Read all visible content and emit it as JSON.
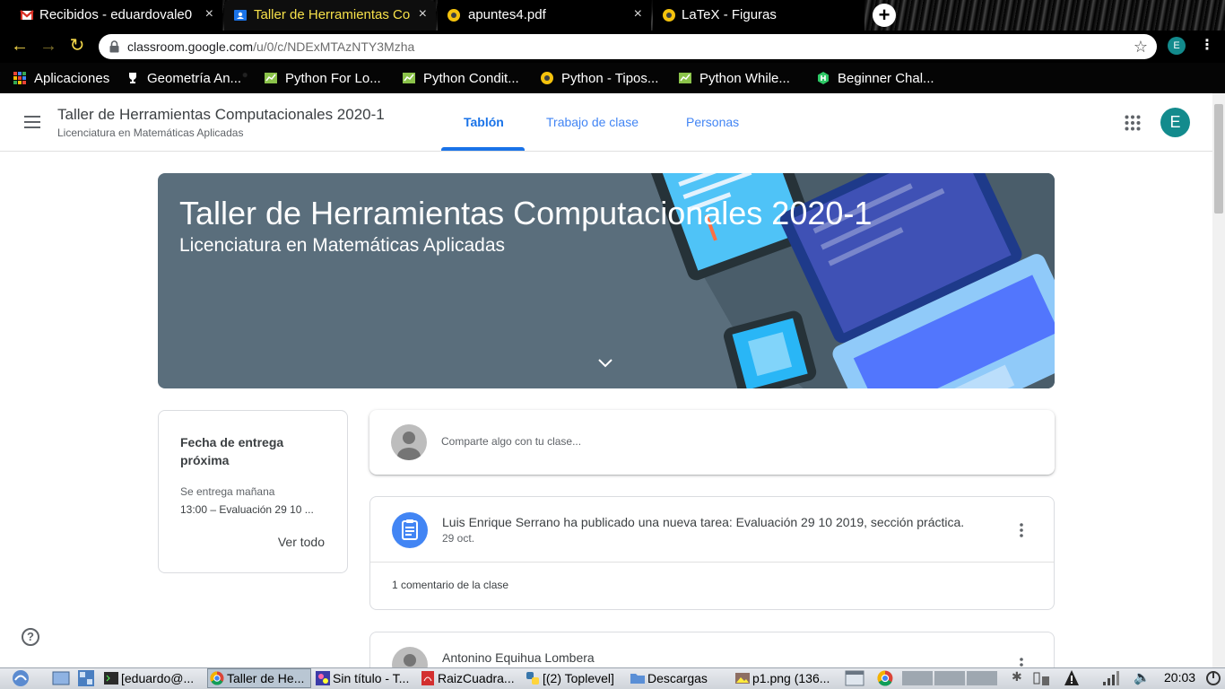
{
  "browser": {
    "tabs": [
      {
        "title": "Recibidos - eduardovale0",
        "icon": "gmail-icon",
        "active": false
      },
      {
        "title": "Taller de Herramientas Co",
        "icon": "classroom-icon",
        "active": true
      },
      {
        "title": "apuntes4.pdf",
        "icon": "globe-icon",
        "active": false
      },
      {
        "title": "LaTeX - Figuras",
        "icon": "globe-icon",
        "active": false
      }
    ],
    "close_glyph": "×",
    "new_tab_glyph": "+",
    "url_host": "classroom.google.com",
    "url_path": "/u/0/c/NDExMTAzNTY3Mzha",
    "profile_initial": "E",
    "bookmarks": [
      {
        "label": "Aplicaciones",
        "icon": "apps-grid-icon"
      },
      {
        "label": "Geometría An...",
        "icon": "trophy-icon"
      },
      {
        "label": "Python For Lo...",
        "icon": "chart-icon"
      },
      {
        "label": "Python Condit...",
        "icon": "chart-icon"
      },
      {
        "label": "Python - Tipos...",
        "icon": "globe-icon"
      },
      {
        "label": "Python While...",
        "icon": "chart-icon"
      },
      {
        "label": "Beginner Chal...",
        "icon": "hackerrank-icon"
      }
    ]
  },
  "header": {
    "course_title": "Taller de Herramientas Computacionales 2020-1",
    "course_subtitle": "Licenciatura en Matemáticas Aplicadas",
    "tabs": [
      {
        "label": "Tablón",
        "active": true
      },
      {
        "label": "Trabajo de clase",
        "active": false
      },
      {
        "label": "Personas",
        "active": false
      }
    ],
    "user_initial": "E",
    "accent": "#1a73e8",
    "avatar_color": "#138b8d"
  },
  "banner": {
    "title": "Taller de Herramientas Computacionales 2020-1",
    "subtitle": "Licenciatura en Matemáticas Aplicadas",
    "color": "#5a6e7c"
  },
  "due": {
    "title": "Fecha de entrega próxima",
    "when": "Se entrega mañana",
    "item": "13:00 – Evaluación 29 10 ...",
    "view_all": "Ver todo"
  },
  "share": {
    "placeholder": "Comparte algo con tu clase..."
  },
  "stream": [
    {
      "text": "Luis Enrique Serrano ha publicado una nueva tarea: Evaluación 29 10 2019, sección práctica.",
      "date": "29 oct.",
      "comments": "1 comentario de la clase"
    },
    {
      "author": "Antonino Equihua Lombera"
    }
  ],
  "help_glyph": "?",
  "taskbar": {
    "items": [
      {
        "label": "[eduardo@...",
        "icon": "terminal-icon"
      },
      {
        "label": "Taller de He...",
        "icon": "chrome-icon",
        "active": true
      },
      {
        "label": "Sin título - T...",
        "icon": "paint-icon"
      },
      {
        "label": "RaizCuadra...",
        "icon": "pdf-icon"
      },
      {
        "label": "[(2) Toplevel]",
        "icon": "python-icon"
      },
      {
        "label": "Descargas",
        "icon": "folder-icon"
      },
      {
        "label": "p1.png (136...",
        "icon": "image-viewer-icon"
      }
    ],
    "clock": "20:03"
  }
}
